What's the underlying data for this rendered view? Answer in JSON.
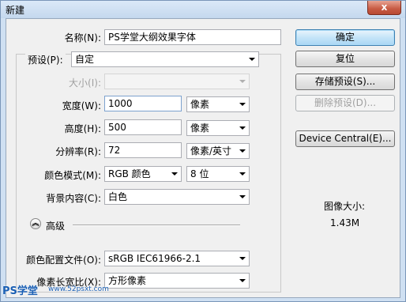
{
  "window": {
    "title": "新建",
    "close_label": "x"
  },
  "form": {
    "name_label": "名称(N):",
    "name_value": "PS学堂大纲效果字体",
    "preset_label": "预设(P):",
    "preset_value": "自定",
    "size_label": "大小(I):",
    "size_value": "",
    "width_label": "宽度(W):",
    "width_value": "1000",
    "width_unit": "像素",
    "height_label": "高度(H):",
    "height_value": "500",
    "height_unit": "像素",
    "resolution_label": "分辨率(R):",
    "resolution_value": "72",
    "resolution_unit": "像素/英寸",
    "color_mode_label": "颜色模式(M):",
    "color_mode_value": "RGB 颜色",
    "bit_depth_value": "8 位",
    "background_label": "背景内容(C):",
    "background_value": "白色",
    "advanced_label": "高级",
    "advanced_icon": "chevron-double-up",
    "color_profile_label": "颜色配置文件(O):",
    "color_profile_value": "sRGB IEC61966-2.1",
    "pixel_aspect_label": "像素长宽比(X):",
    "pixel_aspect_value": "方形像素"
  },
  "buttons": {
    "ok": "确定",
    "reset": "复位",
    "save_preset": "存储预设(S)...",
    "delete_preset": "删除预设(D)...",
    "device_central": "Device Central(E)..."
  },
  "info": {
    "image_size_label": "图像大小:",
    "image_size_value": "1.43M"
  },
  "watermark": {
    "logo_text": "PS学堂",
    "site_text": "www.52psxt.com"
  },
  "colors": {
    "titlebar": "#c4d8ee",
    "close_button": "#c75a43",
    "primary_button": "#a9d7f5"
  }
}
